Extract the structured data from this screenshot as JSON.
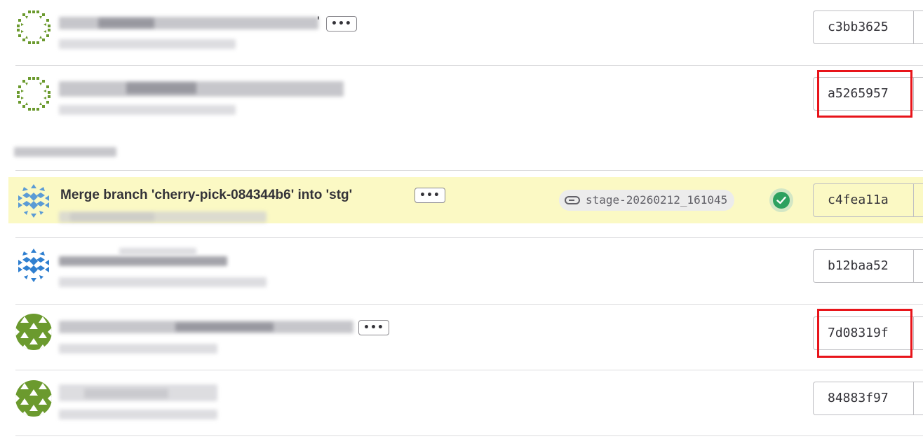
{
  "commits": [
    {
      "sha": "c3bb3625",
      "more_label": "•••",
      "blurred_title": true,
      "trailing_quote": "'"
    },
    {
      "sha": "a5265957",
      "blurred_title": true,
      "highlighted_sha": true
    },
    {
      "sha": "c4fea11a",
      "title": "Merge branch 'cherry-pick-084344b6' into 'stg'",
      "more_label": "•••",
      "tag": "stage-20260212_161045",
      "pipeline_status": "passed",
      "row_highlighted": true
    },
    {
      "sha": "b12baa52",
      "blurred_title": true
    },
    {
      "sha": "7d08319f",
      "more_label": "•••",
      "blurred_title": true,
      "highlighted_sha": true
    },
    {
      "sha": "84883f97",
      "blurred_title": true
    }
  ],
  "colors": {
    "highlight_row": "#fbf9c4",
    "annotation_red": "#e8141a",
    "success_green": "#2da160",
    "avatar_green": "#6b9a2e",
    "avatar_blue": "#2f7fd0"
  },
  "icons": {
    "tag": "tag-icon",
    "pipeline": "check-circle-icon",
    "more": "ellipsis-icon"
  }
}
